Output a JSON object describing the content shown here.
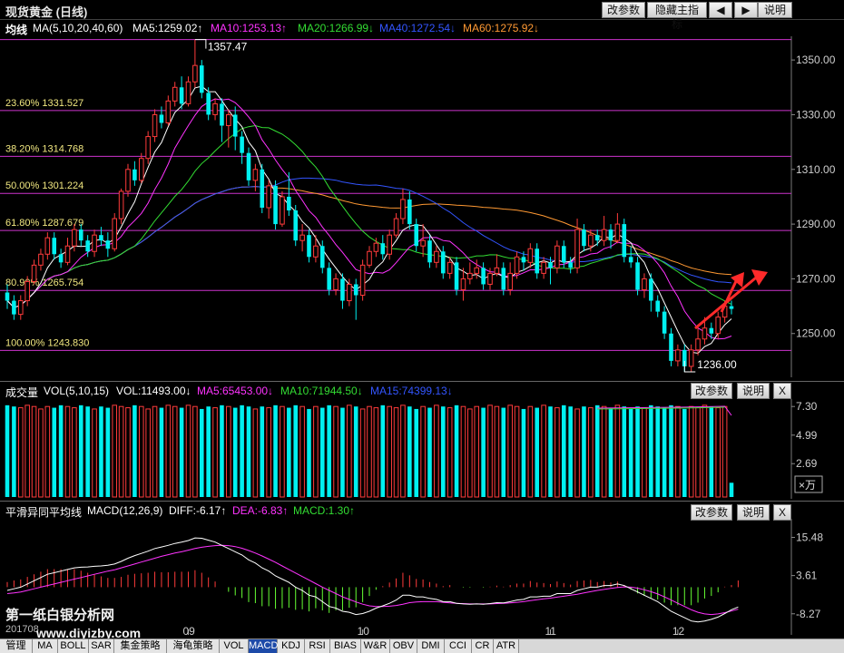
{
  "window": {
    "title": "现货黄金 (日线)",
    "buttons": [
      "改参数",
      "隐藏主指标",
      "◀",
      "▶",
      "说明"
    ]
  },
  "ma_legend": {
    "label": "均线",
    "params": "MA(5,10,20,40,60)",
    "ma5": "MA5:1259.02↑",
    "ma10": "MA10:1253.13↑",
    "ma20": "MA20:1266.99↓",
    "ma40": "MA40:1272.54↓",
    "ma60": "MA60:1275.92↓"
  },
  "colors": {
    "up": "#ff3b3b",
    "down": "#00f0f0",
    "ma5": "#ffffff",
    "ma10": "#ff33ff",
    "ma20": "#33dd33",
    "ma40": "#3355ff",
    "ma60": "#ff9933",
    "fib": "#cc33cc",
    "grid": "#5a0000"
  },
  "price_axis": [
    "1350.00",
    "1330.00",
    "1310.00",
    "1290.00",
    "1270.00",
    "1250.00"
  ],
  "fib_levels": [
    {
      "label": "23.60% 1331.527",
      "value": 1331.527
    },
    {
      "label": "38.20% 1314.768",
      "value": 1314.768
    },
    {
      "label": "50.00% 1301.224",
      "value": 1301.224
    },
    {
      "label": "61.80% 1287.679",
      "value": 1287.679
    },
    {
      "label": "80.90% 1265.754",
      "value": 1265.754
    },
    {
      "label": "100.00% 1243.830",
      "value": 1243.83
    }
  ],
  "top_line_value": 1357.47,
  "annotations": {
    "high": "1357.47",
    "low": "1236.00"
  },
  "vol_legend": {
    "label": "成交量",
    "params": "VOL(5,10,15)",
    "vol": "VOL:11493.00↓",
    "ma5": "MA5:65453.00↓",
    "ma10": "MA10:71944.50↓",
    "ma15": "MA15:74399.13↓"
  },
  "vol_axis": [
    "7.30",
    "4.99",
    "2.69"
  ],
  "vol_unit": "×万",
  "macd_legend": {
    "label": "平滑异同平均线",
    "params": "MACD(12,26,9)",
    "diff": "DIFF:-6.17↑",
    "dea": "DEA:-6.83↑",
    "macd": "MACD:1.30↑"
  },
  "macd_axis": [
    "15.48",
    "3.61",
    "-8.27"
  ],
  "panel_buttons": {
    "params": "改参数",
    "help": "说明",
    "close": "X"
  },
  "x_axis": {
    "start": "201708",
    "months": [
      "09",
      "10",
      "11",
      "12"
    ]
  },
  "watermark": {
    "line1": "第一纸白银分析网",
    "line2": "www.diyizby.com"
  },
  "tabs": [
    "管理",
    "MA",
    "BOLL",
    "SAR",
    "集金策略",
    "海龟策略",
    "VOL",
    "MACD",
    "KDJ",
    "RSI",
    "BIAS",
    "W&R",
    "OBV",
    "DMI",
    "CCI",
    "CR",
    "ATR"
  ],
  "active_tab": "MACD",
  "chart_data": [
    {
      "type": "candlestick",
      "title": "现货黄金 (日线)",
      "ylim": [
        1234,
        1358
      ],
      "candles": [
        [
          1265,
          1262,
          1268,
          1259
        ],
        [
          1262,
          1257,
          1264,
          1255
        ],
        [
          1257,
          1262,
          1264,
          1255
        ],
        [
          1262,
          1269,
          1271,
          1260
        ],
        [
          1269,
          1275,
          1277,
          1268
        ],
        [
          1275,
          1279,
          1281,
          1273
        ],
        [
          1279,
          1285,
          1287,
          1277
        ],
        [
          1285,
          1279,
          1287,
          1277
        ],
        [
          1279,
          1276,
          1281,
          1274
        ],
        [
          1276,
          1282,
          1285,
          1275
        ],
        [
          1282,
          1288,
          1290,
          1280
        ],
        [
          1288,
          1284,
          1290,
          1282
        ],
        [
          1284,
          1280,
          1286,
          1278
        ],
        [
          1280,
          1286,
          1288,
          1278
        ],
        [
          1286,
          1284,
          1289,
          1282
        ],
        [
          1284,
          1281,
          1287,
          1278
        ],
        [
          1281,
          1292,
          1294,
          1280
        ],
        [
          1292,
          1302,
          1303,
          1290
        ],
        [
          1302,
          1310,
          1312,
          1300
        ],
        [
          1310,
          1306,
          1313,
          1304
        ],
        [
          1306,
          1314,
          1316,
          1305
        ],
        [
          1314,
          1322,
          1324,
          1312
        ],
        [
          1322,
          1330,
          1332,
          1320
        ],
        [
          1330,
          1327,
          1333,
          1325
        ],
        [
          1327,
          1335,
          1337,
          1326
        ],
        [
          1335,
          1340,
          1342,
          1333
        ],
        [
          1340,
          1334,
          1344,
          1332
        ],
        [
          1334,
          1342,
          1344,
          1333
        ],
        [
          1342,
          1348,
          1357.47,
          1340
        ],
        [
          1348,
          1338,
          1350,
          1336
        ],
        [
          1338,
          1330,
          1340,
          1328
        ],
        [
          1330,
          1334,
          1336,
          1328
        ],
        [
          1334,
          1326,
          1336,
          1320
        ],
        [
          1326,
          1330,
          1332,
          1318
        ],
        [
          1330,
          1322,
          1333,
          1317
        ],
        [
          1322,
          1316,
          1324,
          1312
        ],
        [
          1316,
          1306,
          1318,
          1304
        ],
        [
          1306,
          1310,
          1312,
          1302
        ],
        [
          1310,
          1296,
          1312,
          1294
        ],
        [
          1296,
          1304,
          1306,
          1292
        ],
        [
          1304,
          1290,
          1306,
          1288
        ],
        [
          1290,
          1300,
          1302,
          1289
        ],
        [
          1300,
          1295,
          1309,
          1293
        ],
        [
          1295,
          1284,
          1297,
          1282
        ],
        [
          1284,
          1286,
          1290,
          1280
        ],
        [
          1286,
          1278,
          1288,
          1276
        ],
        [
          1278,
          1282,
          1286,
          1276
        ],
        [
          1282,
          1274,
          1284,
          1272
        ],
        [
          1274,
          1266,
          1276,
          1264
        ],
        [
          1266,
          1270,
          1272,
          1264
        ],
        [
          1270,
          1262,
          1272,
          1259
        ],
        [
          1262,
          1268,
          1270,
          1260
        ],
        [
          1268,
          1264,
          1270,
          1255
        ],
        [
          1264,
          1275,
          1277,
          1262
        ],
        [
          1275,
          1280,
          1282,
          1274
        ],
        [
          1280,
          1283,
          1285,
          1278
        ],
        [
          1283,
          1279,
          1286,
          1277
        ],
        [
          1279,
          1286,
          1288,
          1277
        ],
        [
          1286,
          1292,
          1294,
          1285
        ],
        [
          1292,
          1299,
          1303,
          1290
        ],
        [
          1299,
          1290,
          1302,
          1288
        ],
        [
          1290,
          1282,
          1292,
          1280
        ],
        [
          1282,
          1284,
          1290,
          1278
        ],
        [
          1284,
          1276,
          1286,
          1274
        ],
        [
          1276,
          1280,
          1282,
          1274
        ],
        [
          1280,
          1272,
          1282,
          1270
        ],
        [
          1272,
          1276,
          1278,
          1270
        ],
        [
          1276,
          1266,
          1278,
          1264
        ],
        [
          1266,
          1270,
          1274,
          1262
        ],
        [
          1270,
          1272,
          1276,
          1268
        ],
        [
          1272,
          1274,
          1277,
          1270
        ],
        [
          1274,
          1268,
          1276,
          1266
        ],
        [
          1268,
          1272,
          1274,
          1266
        ],
        [
          1272,
          1274,
          1279,
          1271
        ],
        [
          1274,
          1266,
          1276,
          1264
        ],
        [
          1266,
          1272,
          1276,
          1264
        ],
        [
          1272,
          1278,
          1280,
          1270
        ],
        [
          1278,
          1276,
          1280,
          1273
        ],
        [
          1276,
          1281,
          1283,
          1274
        ],
        [
          1281,
          1272,
          1283,
          1270
        ],
        [
          1272,
          1276,
          1278,
          1270
        ],
        [
          1276,
          1274,
          1278,
          1268
        ],
        [
          1274,
          1282,
          1284,
          1272
        ],
        [
          1282,
          1276,
          1284,
          1274
        ],
        [
          1276,
          1274,
          1278,
          1272
        ],
        [
          1274,
          1288,
          1292,
          1272
        ],
        [
          1288,
          1282,
          1290,
          1280
        ],
        [
          1282,
          1286,
          1288,
          1280
        ],
        [
          1286,
          1284,
          1288,
          1282
        ],
        [
          1284,
          1288,
          1293,
          1282
        ],
        [
          1288,
          1284,
          1290,
          1281
        ],
        [
          1284,
          1290,
          1294,
          1283
        ],
        [
          1290,
          1278,
          1292,
          1276
        ],
        [
          1278,
          1276,
          1282,
          1274
        ],
        [
          1276,
          1266,
          1278,
          1264
        ],
        [
          1266,
          1270,
          1272,
          1263
        ],
        [
          1270,
          1262,
          1272,
          1258
        ],
        [
          1262,
          1258,
          1264,
          1256
        ],
        [
          1258,
          1250,
          1260,
          1248
        ],
        [
          1250,
          1240,
          1252,
          1238
        ],
        [
          1240,
          1244,
          1246,
          1238
        ],
        [
          1244,
          1238,
          1246,
          1236
        ],
        [
          1238,
          1244,
          1246,
          1236
        ],
        [
          1244,
          1248,
          1252,
          1242
        ],
        [
          1248,
          1252,
          1256,
          1246
        ],
        [
          1252,
          1250,
          1254,
          1248
        ],
        [
          1250,
          1256,
          1258,
          1248
        ],
        [
          1256,
          1260,
          1262,
          1254
        ],
        [
          1260,
          1259,
          1262,
          1257
        ]
      ]
    },
    {
      "type": "bar",
      "title": "成交量",
      "ylim": [
        0,
        7.9
      ],
      "values": [
        7.4,
        7.3,
        7.2,
        7.4,
        7.3,
        7.1,
        7.3,
        7.2,
        7.4,
        7.3,
        7.2,
        7.4,
        7.3,
        7.1,
        7.3,
        7.2,
        7.4,
        7.3,
        7.2,
        7.4,
        7.3,
        7.1,
        7.3,
        7.2,
        7.4,
        7.3,
        7.2,
        7.4,
        7.3,
        7.1,
        7.3,
        7.2,
        7.4,
        7.3,
        7.2,
        7.4,
        7.3,
        7.1,
        7.3,
        7.2,
        7.4,
        7.3,
        7.2,
        7.4,
        7.3,
        7.1,
        7.3,
        7.2,
        7.4,
        7.3,
        7.2,
        7.4,
        7.3,
        7.1,
        7.3,
        7.2,
        7.4,
        7.3,
        7.2,
        7.4,
        7.3,
        7.1,
        7.3,
        7.2,
        7.4,
        7.3,
        7.2,
        7.4,
        7.3,
        7.1,
        7.3,
        7.2,
        7.4,
        7.3,
        7.2,
        7.4,
        7.3,
        7.1,
        7.3,
        7.2,
        7.4,
        7.3,
        7.2,
        7.4,
        7.3,
        7.1,
        7.3,
        7.2,
        7.4,
        7.3,
        7.2,
        7.4,
        7.3,
        7.1,
        7.3,
        7.2,
        7.4,
        7.3,
        7.2,
        7.4,
        7.3,
        7.1,
        7.3,
        7.2,
        7.4,
        7.3,
        7.2,
        7.3,
        1.15
      ]
    },
    {
      "type": "bar",
      "title": "平滑异同平均线",
      "ylim": [
        -12,
        19
      ],
      "diff": [
        -1,
        -0.5,
        0,
        1,
        2,
        3,
        4,
        4.5,
        5,
        5.5,
        6,
        6.2,
        6.3,
        6.5,
        6.6,
        6.8,
        7.2,
        8,
        9,
        9.8,
        10.5,
        11.2,
        12,
        12.5,
        13,
        13.6,
        14,
        14.5,
        15.3,
        15.2,
        14.6,
        14,
        13,
        12,
        11,
        10,
        8.5,
        7.5,
        6,
        5,
        3.5,
        2.5,
        1.5,
        0,
        -1,
        -2.5,
        -3,
        -4.5,
        -6,
        -6.5,
        -7.5,
        -7.8,
        -8.5,
        -8.2,
        -7.5,
        -6.5,
        -5.8,
        -5,
        -4,
        -2.5,
        -2.5,
        -3,
        -3,
        -3.5,
        -3.8,
        -4.5,
        -4.5,
        -5,
        -5.2,
        -5.3,
        -5.2,
        -5.3,
        -5.1,
        -4.8,
        -4.9,
        -4.5,
        -4,
        -3.8,
        -3,
        -3,
        -2.8,
        -2.8,
        -2,
        -2,
        -2,
        -1,
        -0.5,
        0,
        0,
        0.5,
        0.5,
        1,
        0.5,
        -0.5,
        -1.5,
        -2.5,
        -3.5,
        -4.5,
        -6,
        -7.5,
        -8.5,
        -9.5,
        -10.5,
        -10.8,
        -10.5,
        -10,
        -9.3,
        -8.2,
        -7,
        -6.17
      ],
      "dea": [
        -2,
        -1.8,
        -1.5,
        -1,
        -0.5,
        0,
        0.5,
        1,
        1.5,
        2,
        2.5,
        3,
        3.5,
        4,
        4.5,
        5,
        5.4,
        6,
        6.6,
        7.2,
        7.8,
        8.4,
        9,
        9.6,
        10.1,
        10.6,
        11,
        11.5,
        12,
        12.4,
        12.7,
        12.9,
        13,
        12.9,
        12.6,
        12.1,
        11.4,
        10.6,
        9.7,
        8.7,
        7.7,
        6.6,
        5.5,
        4.4,
        3.3,
        2.2,
        1.1,
        0,
        -1,
        -2,
        -3,
        -3.8,
        -4.6,
        -5.3,
        -5.8,
        -6,
        -6,
        -5.9,
        -5.7,
        -5.3,
        -4.8,
        -4.6,
        -4.5,
        -4.5,
        -4.5,
        -4.7,
        -4.9,
        -5,
        -5.1,
        -5.2,
        -5.2,
        -5.2,
        -5.2,
        -5.1,
        -5,
        -4.9,
        -4.7,
        -4.5,
        -4.2,
        -3.9,
        -3.6,
        -3.4,
        -3.1,
        -2.8,
        -2.5,
        -2.2,
        -1.8,
        -1.4,
        -1,
        -0.7,
        -0.4,
        -0.1,
        0.1,
        0,
        -0.3,
        -0.8,
        -1.4,
        -2.1,
        -3,
        -4,
        -5,
        -6,
        -7,
        -7.8,
        -8.3,
        -8.5,
        -8.3,
        -7.9,
        -7.4,
        -6.83
      ],
      "macd": [
        1,
        1.3,
        1.5,
        2,
        2.5,
        3,
        3.5,
        3.5,
        3.5,
        3.5,
        3.5,
        3.2,
        2.8,
        2.5,
        2.1,
        1.8,
        1.8,
        2,
        2.4,
        2.6,
        2.7,
        2.8,
        3,
        2.9,
        2.9,
        3,
        3,
        3,
        3.3,
        2.8,
        1.9,
        1.1,
        0,
        -0.9,
        -1.6,
        -2.1,
        -2.9,
        -3.1,
        -3.7,
        -3.7,
        -4.2,
        -4.1,
        -4,
        -4.4,
        -4.3,
        -4.7,
        -4.1,
        -4.5,
        -5,
        -4.5,
        -4.5,
        -4,
        -3.9,
        -2.9,
        -1.7,
        -0.5,
        0.2,
        0.9,
        1.7,
        2.8,
        2.3,
        1.6,
        1.5,
        1,
        0.7,
        0.2,
        0.4,
        0,
        -0.1,
        -0.1,
        0,
        -0.1,
        0.1,
        0.3,
        0.1,
        0.4,
        0.7,
        0.7,
        1.2,
        0.9,
        0.8,
        0.6,
        1.1,
        0.8,
        0.5,
        1.2,
        1.3,
        1.4,
        1,
        1.2,
        0.9,
        1.1,
        0.4,
        -0.5,
        -1.2,
        -1.7,
        -2.1,
        -2.4,
        -3,
        -3.5,
        -3.5,
        -3.5,
        -3.5,
        -3,
        -2.2,
        -1.7,
        -1,
        0.1,
        0.4,
        1.3
      ]
    }
  ]
}
